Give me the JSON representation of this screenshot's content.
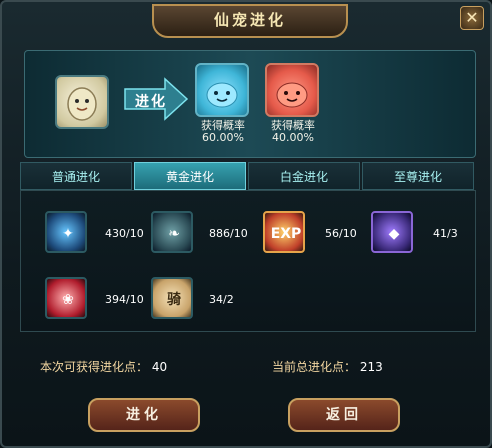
{
  "window": {
    "title": "仙宠进化",
    "close_label": "✕"
  },
  "evolution": {
    "evolve_label": "进化",
    "results": [
      {
        "label": "获得概率",
        "probability": "60.00%"
      },
      {
        "label": "获得概率",
        "probability": "40.00%"
      }
    ]
  },
  "tabs": [
    {
      "label": "普通进化"
    },
    {
      "label": "黄金进化"
    },
    {
      "label": "白金进化"
    },
    {
      "label": "至尊进化"
    }
  ],
  "active_tab_index": 1,
  "materials": [
    {
      "icon": "blue-shards-icon",
      "count": "430/10"
    },
    {
      "icon": "leaf-icon",
      "count": "886/10"
    },
    {
      "icon": "exp-icon",
      "count": "56/10",
      "glyph": "EXP"
    },
    {
      "icon": "gem-icon",
      "count": "41/3"
    },
    {
      "icon": "rose-icon",
      "count": "394/10"
    },
    {
      "icon": "mount-icon",
      "count": "34/2",
      "glyph": "骑"
    }
  ],
  "points": {
    "current_label": "本次可获得进化点：",
    "current_value": "40",
    "total_label": "当前总进化点：",
    "total_value": "213"
  },
  "buttons": {
    "evolve": "进化",
    "back": "返回"
  },
  "colors": {
    "accent": "#36a2b0",
    "gold": "#c8a060",
    "button_bg": "#8b4a2c"
  }
}
